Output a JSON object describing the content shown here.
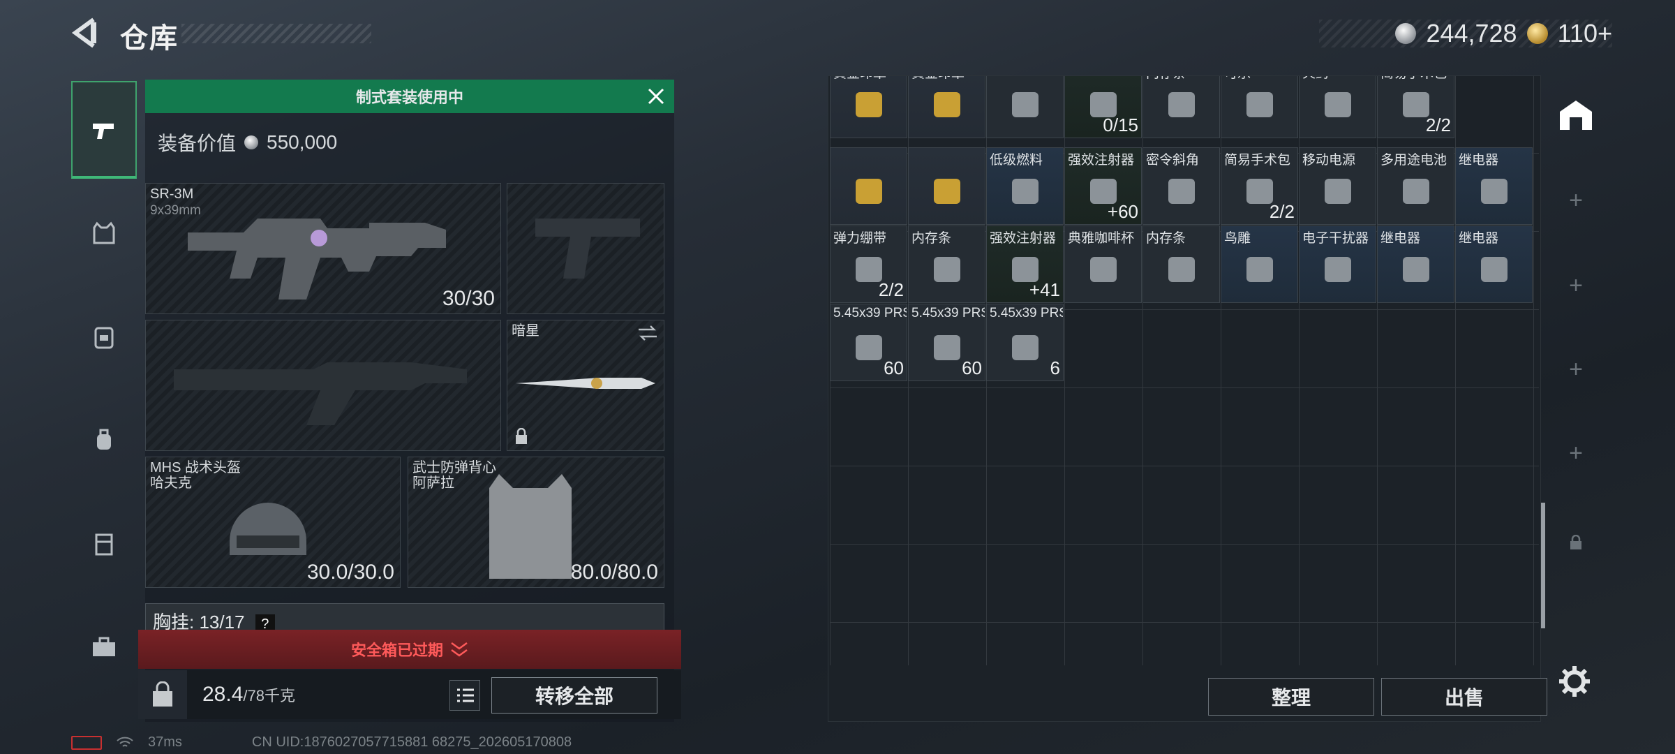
{
  "header": {
    "title": "仓库",
    "silver": "244,728",
    "gold": "110+"
  },
  "loadout": {
    "banner": "制式套装使用中",
    "value_label": "装备价值",
    "value": "550,000",
    "primary": {
      "name": "SR-3M",
      "caliber": "9x39mm",
      "count": "30/30"
    },
    "melee": {
      "name": "暗星"
    },
    "helmet": {
      "name": "MHS 战术头盔",
      "sub": "哈夫克",
      "durability": "30.0/30.0"
    },
    "armor": {
      "name": "武士防弹背心",
      "sub": "阿萨拉",
      "durability": "80.0/80.0"
    },
    "chest_rig": "胸挂: 13/17",
    "chest_help": "?",
    "safebox": "安全箱已过期",
    "weight": "28.4",
    "weight_max": "/78千克",
    "transfer_all": "转移全部"
  },
  "stash": {
    "row0": [
      {
        "name": "黄金印章",
        "count": ""
      },
      {
        "name": "黄金印章",
        "count": ""
      },
      {
        "name": "",
        "count": ""
      },
      {
        "name": "",
        "count": "0/15"
      },
      {
        "name": "内存条",
        "count": ""
      },
      {
        "name": "可乐",
        "count": ""
      },
      {
        "name": "火药",
        "count": ""
      },
      {
        "name": "简易手术包",
        "count": "2/2"
      }
    ],
    "row1": [
      {
        "name": "",
        "count": ""
      },
      {
        "name": "",
        "count": ""
      },
      {
        "name": "低级燃料",
        "count": ""
      },
      {
        "name": "强效注射器",
        "count": "+60"
      },
      {
        "name": "密令斜角",
        "count": ""
      },
      {
        "name": "简易手术包",
        "count": "2/2"
      },
      {
        "name": "移动电源",
        "count": ""
      },
      {
        "name": "多用途电池",
        "count": ""
      },
      {
        "name": "继电器",
        "count": ""
      }
    ],
    "row2": [
      {
        "name": "弹力绷带",
        "count": "2/2"
      },
      {
        "name": "内存条",
        "count": ""
      },
      {
        "name": "强效注射器",
        "count": "+41"
      },
      {
        "name": "典雅咖啡杯",
        "count": ""
      },
      {
        "name": "内存条",
        "count": ""
      },
      {
        "name": "鸟雕",
        "count": ""
      },
      {
        "name": "电子干扰器",
        "count": ""
      },
      {
        "name": "继电器",
        "count": ""
      },
      {
        "name": "继电器",
        "count": ""
      }
    ],
    "row3": [
      {
        "name": "5.45x39 PRS",
        "count": "60"
      },
      {
        "name": "5.45x39 PRS",
        "count": "60"
      },
      {
        "name": "5.45x39 PRS",
        "count": "6"
      }
    ],
    "sort": "整理",
    "sell": "出售"
  },
  "footer": {
    "ping": "37ms",
    "uid": "CN UID:1876027057715881 68275_202605170808"
  }
}
